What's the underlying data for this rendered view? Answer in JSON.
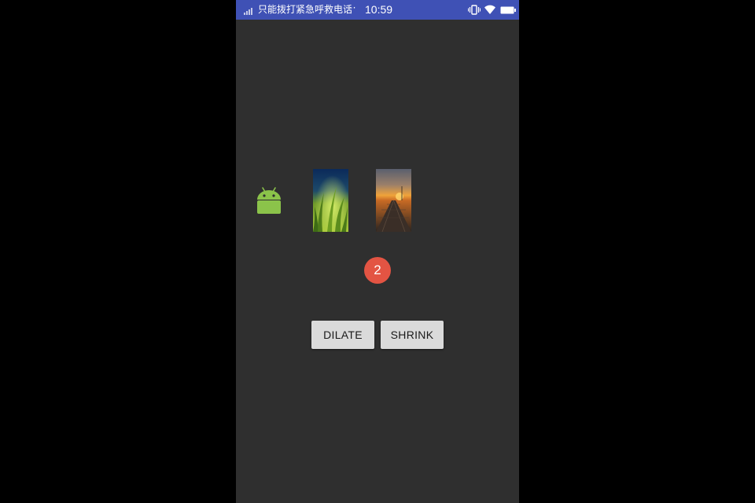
{
  "status_bar": {
    "carrier_text": "只能拨打紧急呼救电话",
    "more_indicator": "···",
    "time": "10:59",
    "background_color": "#3f51b5",
    "icons": [
      "signal-icon",
      "vibrate-icon",
      "wifi-icon",
      "battery-icon"
    ]
  },
  "content": {
    "background_color": "#2f2f2f",
    "images": [
      "android-icon",
      "grass-photo",
      "pier-sunset-photo"
    ],
    "badge": {
      "count": "2",
      "color": "#e35443"
    },
    "buttons": {
      "dilate_label": "DILATE",
      "shrink_label": "SHRINK"
    }
  }
}
